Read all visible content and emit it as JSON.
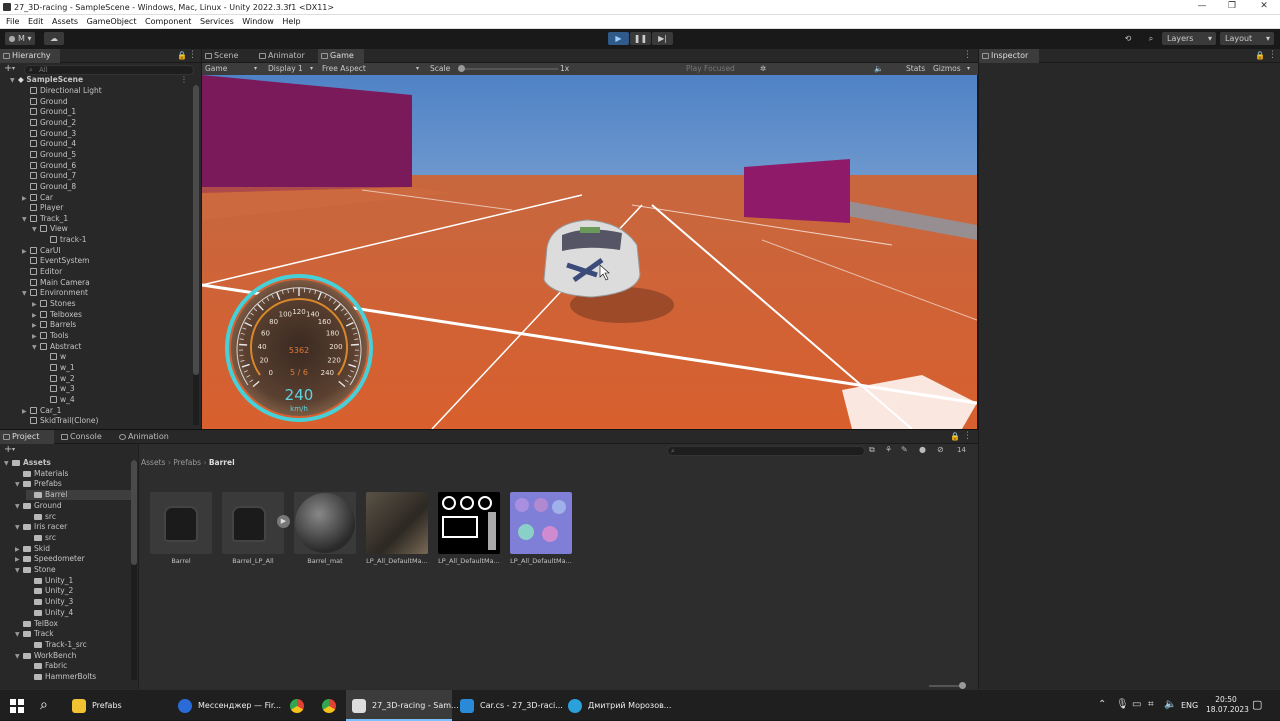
{
  "window": {
    "title": "27_3D-racing - SampleScene - Windows, Mac, Linux - Unity 2022.3.3f1 <DX11>"
  },
  "menu": [
    "File",
    "Edit",
    "Assets",
    "GameObject",
    "Component",
    "Services",
    "Window",
    "Help"
  ],
  "toolbar": {
    "account": "M",
    "layers": "Layers",
    "layout": "Layout"
  },
  "hierarchy": {
    "tab": "Hierarchy",
    "search_placeholder": "All",
    "scene": "SampleScene",
    "items": [
      {
        "label": "Directional Light",
        "depth": 1,
        "arrow": ""
      },
      {
        "label": "Ground",
        "depth": 1,
        "arrow": ""
      },
      {
        "label": "Ground_1",
        "depth": 1,
        "arrow": ""
      },
      {
        "label": "Ground_2",
        "depth": 1,
        "arrow": ""
      },
      {
        "label": "Ground_3",
        "depth": 1,
        "arrow": ""
      },
      {
        "label": "Ground_4",
        "depth": 1,
        "arrow": ""
      },
      {
        "label": "Ground_5",
        "depth": 1,
        "arrow": ""
      },
      {
        "label": "Ground_6",
        "depth": 1,
        "arrow": ""
      },
      {
        "label": "Ground_7",
        "depth": 1,
        "arrow": ""
      },
      {
        "label": "Ground_8",
        "depth": 1,
        "arrow": ""
      },
      {
        "label": "Car",
        "depth": 1,
        "arrow": "▶"
      },
      {
        "label": "Player",
        "depth": 1,
        "arrow": ""
      },
      {
        "label": "Track_1",
        "depth": 1,
        "arrow": "▼"
      },
      {
        "label": "View",
        "depth": 2,
        "arrow": "▼"
      },
      {
        "label": "track-1",
        "depth": 3,
        "arrow": ""
      },
      {
        "label": "CarUI",
        "depth": 1,
        "arrow": "▶"
      },
      {
        "label": "EventSystem",
        "depth": 1,
        "arrow": ""
      },
      {
        "label": "Editor",
        "depth": 1,
        "arrow": ""
      },
      {
        "label": "Main Camera",
        "depth": 1,
        "arrow": ""
      },
      {
        "label": "Environment",
        "depth": 1,
        "arrow": "▼"
      },
      {
        "label": "Stones",
        "depth": 2,
        "arrow": "▶"
      },
      {
        "label": "Telboxes",
        "depth": 2,
        "arrow": "▶"
      },
      {
        "label": "Barrels",
        "depth": 2,
        "arrow": "▶"
      },
      {
        "label": "Tools",
        "depth": 2,
        "arrow": "▶"
      },
      {
        "label": "Abstract",
        "depth": 2,
        "arrow": "▼"
      },
      {
        "label": "w",
        "depth": 3,
        "arrow": ""
      },
      {
        "label": "w_1",
        "depth": 3,
        "arrow": ""
      },
      {
        "label": "w_2",
        "depth": 3,
        "arrow": ""
      },
      {
        "label": "w_3",
        "depth": 3,
        "arrow": ""
      },
      {
        "label": "w_4",
        "depth": 3,
        "arrow": ""
      },
      {
        "label": "Car_1",
        "depth": 1,
        "arrow": "▶"
      },
      {
        "label": "SkidTrail(Clone)",
        "depth": 1,
        "arrow": ""
      }
    ]
  },
  "view_tabs": {
    "scene": "Scene",
    "animator": "Animator",
    "game": "Game"
  },
  "game_bar": {
    "mode": "Game",
    "display": "Display 1",
    "aspect": "Free Aspect",
    "scale_label": "Scale",
    "scale_value": "1x",
    "play_focused": "Play Focused",
    "stats": "Stats",
    "gizmos": "Gizmos"
  },
  "hud": {
    "speed": "240",
    "unit": "km/h",
    "rpm": "5362",
    "gear": "5 / 6",
    "ticks": [
      "0",
      "20",
      "40",
      "60",
      "80",
      "100",
      "120",
      "140",
      "160",
      "180",
      "200",
      "220",
      "240"
    ]
  },
  "inspector": {
    "tab": "Inspector"
  },
  "project": {
    "tabs": {
      "project": "Project",
      "console": "Console",
      "animation": "Animation"
    },
    "breadcrumb": [
      "Assets",
      "Prefabs",
      "Barrel"
    ],
    "count": "14",
    "tree": [
      {
        "label": "Assets",
        "depth": 0,
        "arrow": "▼",
        "bold": true
      },
      {
        "label": "Materials",
        "depth": 1,
        "arrow": ""
      },
      {
        "label": "Prefabs",
        "depth": 1,
        "arrow": "▼"
      },
      {
        "label": "Barrel",
        "depth": 2,
        "arrow": "",
        "selected": true
      },
      {
        "label": "Ground",
        "depth": 1,
        "arrow": "▼"
      },
      {
        "label": "src",
        "depth": 2,
        "arrow": ""
      },
      {
        "label": "Iris racer",
        "depth": 1,
        "arrow": "▼"
      },
      {
        "label": "src",
        "depth": 2,
        "arrow": ""
      },
      {
        "label": "Skid",
        "depth": 1,
        "arrow": "▶"
      },
      {
        "label": "Speedometer",
        "depth": 1,
        "arrow": "▶"
      },
      {
        "label": "Stone",
        "depth": 1,
        "arrow": "▼"
      },
      {
        "label": "Unity_1",
        "depth": 2,
        "arrow": ""
      },
      {
        "label": "Unity_2",
        "depth": 2,
        "arrow": ""
      },
      {
        "label": "Unity_3",
        "depth": 2,
        "arrow": ""
      },
      {
        "label": "Unity_4",
        "depth": 2,
        "arrow": ""
      },
      {
        "label": "TelBox",
        "depth": 1,
        "arrow": ""
      },
      {
        "label": "Track",
        "depth": 1,
        "arrow": "▼"
      },
      {
        "label": "Track-1_src",
        "depth": 2,
        "arrow": ""
      },
      {
        "label": "WorkBench",
        "depth": 1,
        "arrow": "▼"
      },
      {
        "label": "Fabric",
        "depth": 2,
        "arrow": ""
      },
      {
        "label": "HammerBolts",
        "depth": 2,
        "arrow": ""
      }
    ],
    "assets": [
      "Barrel",
      "Barrel_LP_All",
      "Barrel_mat",
      "LP_All_DefaultMa...",
      "LP_All_DefaultMa...",
      "LP_All_DefaultMa..."
    ]
  },
  "taskbar": {
    "apps": [
      "Prefabs",
      "Мессенджер — Fir...",
      "",
      "",
      "27_3D-racing - Sam...",
      "Car.cs - 27_3D-raci...",
      "Дмитрий Морозов..."
    ],
    "lang": "ENG",
    "time": "20:50",
    "date": "18.07.2023"
  }
}
